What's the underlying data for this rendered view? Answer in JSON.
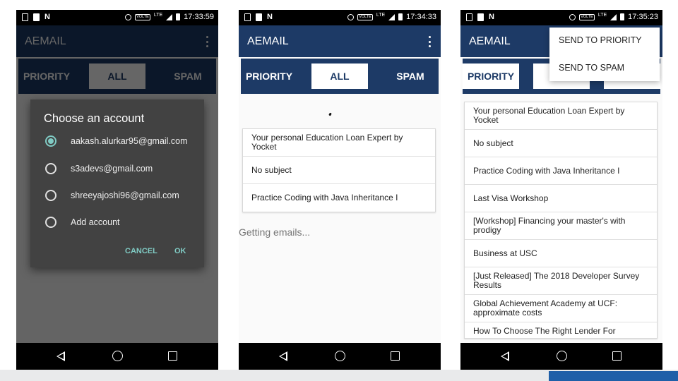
{
  "status_times": [
    "17:33:59",
    "17:34:33",
    "17:35:23"
  ],
  "app_title": "AEMAIL",
  "tabs": [
    "PRIORITY",
    "ALL",
    "SPAM"
  ],
  "dialog": {
    "title": "Choose an account",
    "accounts": [
      "aakash.alurkar95@gmail.com",
      "s3adevs@gmail.com",
      "shreeyajoshi96@gmail.com",
      "Add account"
    ],
    "cancel": "CANCEL",
    "ok": "OK"
  },
  "screen2": {
    "emails": [
      "Your personal Education Loan Expert by Yocket",
      "No subject",
      "Practice Coding with Java Inheritance I"
    ],
    "loading": "Getting emails..."
  },
  "screen3": {
    "emails": [
      "Your personal Education Loan Expert by Yocket",
      "No subject",
      "Practice Coding with Java Inheritance I",
      "Last Visa Workshop",
      "[Workshop] Financing your master's with prodigy",
      "Business at USC",
      "[Just Released] The 2018 Developer Survey Results",
      "Global Achievement Academy at UCF: approximate costs",
      "How To Choose The Right Lender For"
    ],
    "menu": [
      "SEND TO PRIORITY",
      "SEND TO SPAM"
    ]
  },
  "colors": {
    "appbar": "#1d3a66",
    "accent": "#80cbc4",
    "dialog": "#424242",
    "slide_accent": "#1f5fa8"
  }
}
